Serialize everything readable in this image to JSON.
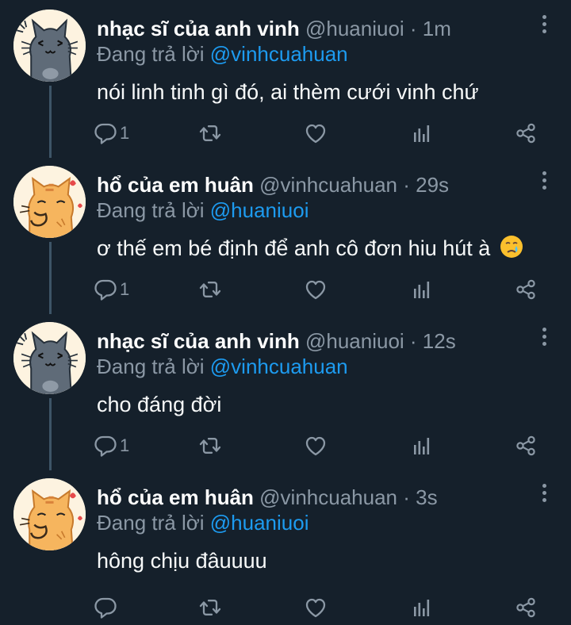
{
  "colors": {
    "background": "#15202b",
    "name": "#ffffff",
    "meta": "#8b98a5",
    "mention": "#1d9bf0",
    "thread_line": "#3d5466"
  },
  "tweets": [
    {
      "display_name": "nhạc sĩ của anh vinh",
      "handle_time": "@huaniuoi · 1m",
      "reply_prefix": "Đang trả lời ",
      "reply_to": "@vinhcuahuan",
      "text": "nói linh tinh gì đó, ai thèm cưới vinh chứ",
      "reply_count": "1",
      "avatar": "gray-cat-avatar"
    },
    {
      "display_name": "hổ của em huân",
      "handle_time": "@vinhcuahuan · 29s",
      "reply_prefix": "Đang trả lời ",
      "reply_to": "@huaniuoi",
      "text": "ơ thế em bé định để anh cô đơn hiu hút à",
      "emoji": "crying-face-emoji",
      "reply_count": "1",
      "avatar": "orange-cat-avatar"
    },
    {
      "display_name": "nhạc sĩ của anh vinh",
      "handle_time": "@huaniuoi · 12s",
      "reply_prefix": "Đang trả lời ",
      "reply_to": "@vinhcuahuan",
      "text": "cho đáng đời",
      "reply_count": "1",
      "avatar": "gray-cat-avatar"
    },
    {
      "display_name": "hổ của em huân",
      "handle_time": "@vinhcuahuan · 3s",
      "reply_prefix": "Đang trả lời ",
      "reply_to": "@huaniuoi",
      "text": "hông chịu đâuuuu",
      "reply_count": "",
      "avatar": "orange-cat-avatar"
    }
  ],
  "action_icons": [
    "reply-icon",
    "retweet-icon",
    "like-icon",
    "analytics-icon",
    "share-icon"
  ]
}
